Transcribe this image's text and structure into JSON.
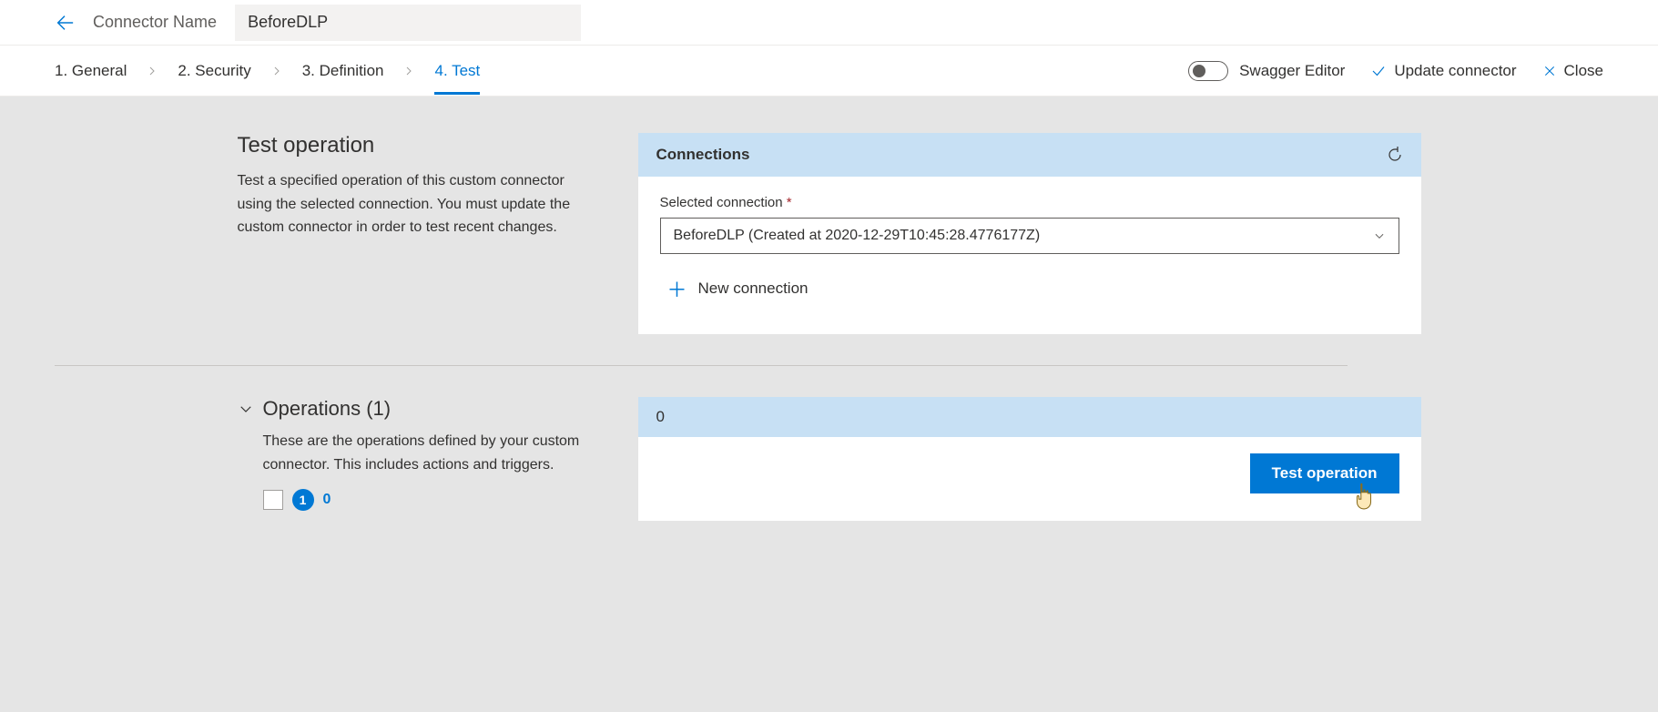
{
  "header": {
    "label": "Connector Name",
    "value": "BeforeDLP"
  },
  "steps": {
    "items": [
      "1. General",
      "2. Security",
      "3. Definition",
      "4. Test"
    ],
    "activeIndex": 3
  },
  "actions": {
    "swagger": "Swagger Editor",
    "update": "Update connector",
    "close": "Close"
  },
  "testSection": {
    "title": "Test operation",
    "desc": "Test a specified operation of this custom connector using the selected connection. You must update the custom connector in order to test recent changes."
  },
  "connections": {
    "heading": "Connections",
    "fieldLabel": "Selected connection",
    "selected": "BeforeDLP (Created at 2020-12-29T10:45:28.4776177Z)",
    "newLabel": "New connection"
  },
  "operations": {
    "heading": "Operations (1)",
    "desc": "These are the operations defined by your custom connector. This includes actions and triggers.",
    "badge1": "1",
    "badge2": "0"
  },
  "opPanel": {
    "heading": "0",
    "testBtn": "Test operation"
  }
}
